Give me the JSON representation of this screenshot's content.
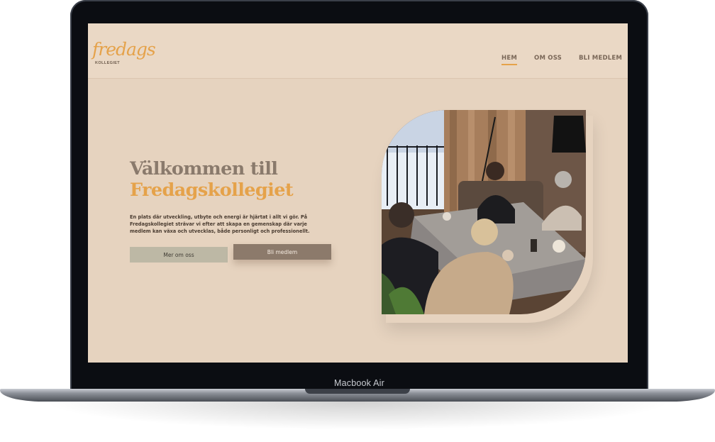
{
  "device": {
    "model_label": "Macbook Air"
  },
  "logo": {
    "script": "fredags",
    "subtitle": "KOLLEGIET"
  },
  "nav": [
    {
      "label": "HEM",
      "active": true
    },
    {
      "label": "OM OSS",
      "active": false
    },
    {
      "label": "BLI MEDLEM",
      "active": false
    }
  ],
  "hero": {
    "title_line1": "Välkommen till",
    "title_line2": "Fredagskollegiet",
    "text": "En plats där utveckling, utbyte och energi är hjärtat i allt vi gör. På Fredagskollegiet strävar vi efter att skapa en gemenskap där varje medlem kan växa och utvecklas, både personligt och professionellt.",
    "btn_more": "Mer om oss",
    "btn_join": "Bli medlem"
  },
  "colors": {
    "accent": "#e5a24a",
    "background": "#e6d3bf",
    "header": "#ead8c5",
    "title_gray": "#8a7a6c",
    "button_secondary": "#bdb8a5",
    "button_primary": "#8c7a6b"
  }
}
